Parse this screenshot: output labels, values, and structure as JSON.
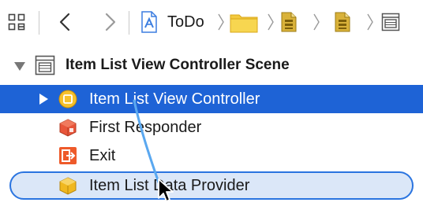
{
  "jumpbar": {
    "grid_button": {
      "icon": "related-items-grid-icon"
    },
    "back_button": {
      "icon": "chevron-left-icon"
    },
    "forward_button": {
      "icon": "chevron-right-icon"
    },
    "breadcrumbs": [
      {
        "label": "ToDo",
        "icon": "project-file-icon"
      },
      {
        "label": "",
        "icon": "folder-icon"
      },
      {
        "label": "",
        "icon": "storyboard-file-icon"
      },
      {
        "label": "",
        "icon": "storyboard-file-icon"
      },
      {
        "label": "",
        "icon": "scene-icon"
      }
    ]
  },
  "outline": {
    "scene": {
      "title": "Item List View Controller Scene",
      "icon": "scene-icon",
      "expanded": true
    },
    "items": [
      {
        "label": "Item List View Controller",
        "icon": "view-controller-icon",
        "selected": true,
        "collapsed": true
      },
      {
        "label": "First Responder",
        "icon": "first-responder-cube-icon",
        "selected": false
      },
      {
        "label": "Exit",
        "icon": "exit-icon",
        "selected": false
      },
      {
        "label": "Item List Data Provider",
        "icon": "object-cube-icon",
        "selected": false,
        "drop_target": true
      }
    ]
  },
  "colors": {
    "selection": "#1e63d6",
    "drop_border": "#2a74e0",
    "drop_fill": "#dbe7f8",
    "drag_line": "#5aa8f0",
    "folder": "#f1c232",
    "storyboard": "#c8a020"
  }
}
